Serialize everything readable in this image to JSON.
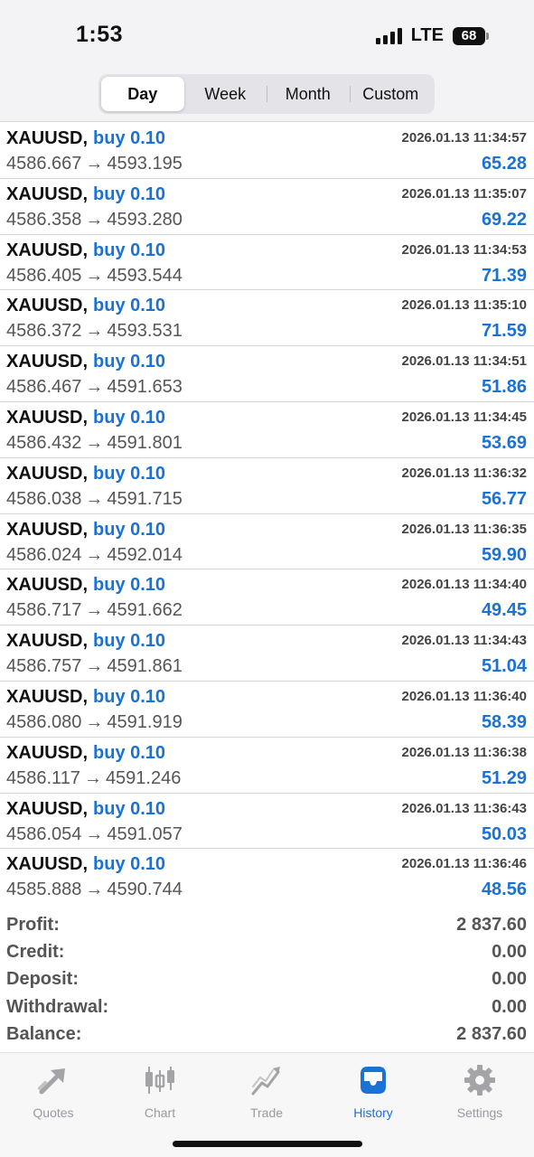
{
  "status_bar": {
    "time": "1:53",
    "network": "LTE",
    "battery": "68"
  },
  "segments": [
    {
      "label": "Day",
      "active": true
    },
    {
      "label": "Week",
      "active": false
    },
    {
      "label": "Month",
      "active": false
    },
    {
      "label": "Custom",
      "active": false
    }
  ],
  "trades": [
    {
      "symbol": "XAUUSD",
      "side": "buy 0.10",
      "open": "4586.667",
      "close": "4593.195",
      "time": "2026.01.13 11:34:57",
      "profit": "65.28"
    },
    {
      "symbol": "XAUUSD",
      "side": "buy 0.10",
      "open": "4586.358",
      "close": "4593.280",
      "time": "2026.01.13 11:35:07",
      "profit": "69.22"
    },
    {
      "symbol": "XAUUSD",
      "side": "buy 0.10",
      "open": "4586.405",
      "close": "4593.544",
      "time": "2026.01.13 11:34:53",
      "profit": "71.39"
    },
    {
      "symbol": "XAUUSD",
      "side": "buy 0.10",
      "open": "4586.372",
      "close": "4593.531",
      "time": "2026.01.13 11:35:10",
      "profit": "71.59"
    },
    {
      "symbol": "XAUUSD",
      "side": "buy 0.10",
      "open": "4586.467",
      "close": "4591.653",
      "time": "2026.01.13 11:34:51",
      "profit": "51.86"
    },
    {
      "symbol": "XAUUSD",
      "side": "buy 0.10",
      "open": "4586.432",
      "close": "4591.801",
      "time": "2026.01.13 11:34:45",
      "profit": "53.69"
    },
    {
      "symbol": "XAUUSD",
      "side": "buy 0.10",
      "open": "4586.038",
      "close": "4591.715",
      "time": "2026.01.13 11:36:32",
      "profit": "56.77"
    },
    {
      "symbol": "XAUUSD",
      "side": "buy 0.10",
      "open": "4586.024",
      "close": "4592.014",
      "time": "2026.01.13 11:36:35",
      "profit": "59.90"
    },
    {
      "symbol": "XAUUSD",
      "side": "buy 0.10",
      "open": "4586.717",
      "close": "4591.662",
      "time": "2026.01.13 11:34:40",
      "profit": "49.45"
    },
    {
      "symbol": "XAUUSD",
      "side": "buy 0.10",
      "open": "4586.757",
      "close": "4591.861",
      "time": "2026.01.13 11:34:43",
      "profit": "51.04"
    },
    {
      "symbol": "XAUUSD",
      "side": "buy 0.10",
      "open": "4586.080",
      "close": "4591.919",
      "time": "2026.01.13 11:36:40",
      "profit": "58.39"
    },
    {
      "symbol": "XAUUSD",
      "side": "buy 0.10",
      "open": "4586.117",
      "close": "4591.246",
      "time": "2026.01.13 11:36:38",
      "profit": "51.29"
    },
    {
      "symbol": "XAUUSD",
      "side": "buy 0.10",
      "open": "4586.054",
      "close": "4591.057",
      "time": "2026.01.13 11:36:43",
      "profit": "50.03"
    },
    {
      "symbol": "XAUUSD",
      "side": "buy 0.10",
      "open": "4585.888",
      "close": "4590.744",
      "time": "2026.01.13 11:36:46",
      "profit": "48.56"
    }
  ],
  "summary": [
    {
      "label": "Profit:",
      "value": "2 837.60"
    },
    {
      "label": "Credit:",
      "value": "0.00"
    },
    {
      "label": "Deposit:",
      "value": "0.00"
    },
    {
      "label": "Withdrawal:",
      "value": "0.00"
    },
    {
      "label": "Balance:",
      "value": "2 837.60"
    }
  ],
  "tabs": [
    {
      "label": "Quotes",
      "icon": "quotes-icon",
      "active": false
    },
    {
      "label": "Chart",
      "icon": "chart-icon",
      "active": false
    },
    {
      "label": "Trade",
      "icon": "trade-icon",
      "active": false
    },
    {
      "label": "History",
      "icon": "history-icon",
      "active": true
    },
    {
      "label": "Settings",
      "icon": "settings-icon",
      "active": false
    }
  ],
  "colors": {
    "accent": "#1a72d4",
    "inactive": "#9a9aa0",
    "text": "#111111",
    "muted": "#555555"
  }
}
